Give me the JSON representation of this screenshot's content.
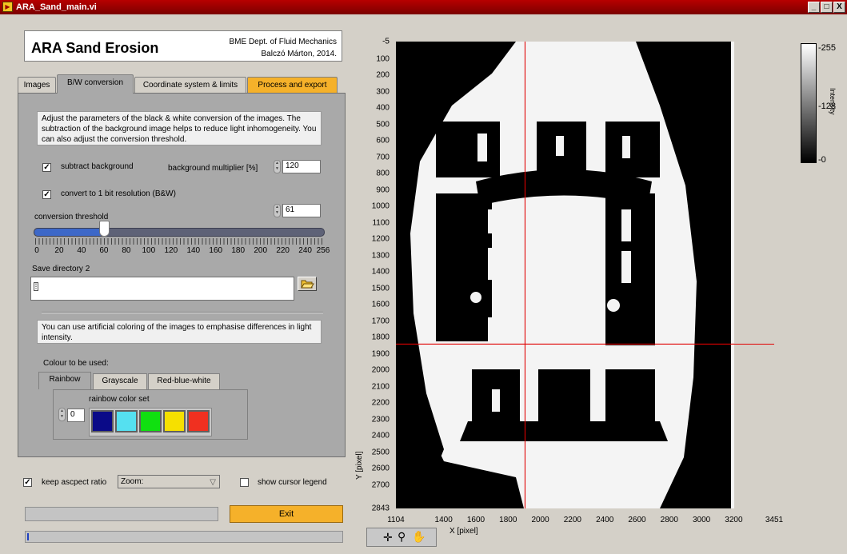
{
  "window": {
    "title": "ARA_Sand_main.vi",
    "min": "_",
    "max": "□",
    "close": "X"
  },
  "header": {
    "app_title": "ARA Sand Erosion",
    "dept": "BME Dept. of Fluid Mechanics",
    "author": "Balczó Márton, 2014."
  },
  "tabs": [
    {
      "label": "Images"
    },
    {
      "label": "B/W conversion"
    },
    {
      "label": "Coordinate system & limits"
    },
    {
      "label": "Process and export"
    }
  ],
  "bw": {
    "description": "Adjust  the parameters of the black & white conversion of the images. The subtraction of the background image helps to  reduce light inhomogeneity. You can also adjust the conversion threshold.",
    "subtract_label": "subtract background",
    "multiplier_label": "background multiplier [%]",
    "multiplier_value": "120",
    "convert_label": "convert to 1 bit resolution (B&W)",
    "threshold_label": "conversion threshold",
    "threshold_value": "61",
    "threshold_fraction": 0.238,
    "ticks": [
      "0",
      "20",
      "40",
      "60",
      "80",
      "100",
      "120",
      "140",
      "160",
      "180",
      "200",
      "220",
      "240",
      "256"
    ],
    "save_dir_label": "Save directory 2",
    "save_dir_value": "",
    "coloring_note": "You can use artificial coloring of the images to emphasise differences in light intensity.",
    "colour_label": "Colour to be used:",
    "colour_tabs": [
      {
        "label": "Rainbow"
      },
      {
        "label": "Grayscale"
      },
      {
        "label": "Red-blue-white"
      }
    ],
    "rainbow_label": "rainbow color set",
    "rainbow_index": "0",
    "swatches": [
      "#0a0a88",
      "#55e0f0",
      "#10e010",
      "#f6e000",
      "#f03020"
    ]
  },
  "bottom": {
    "keep_aspect_label": "keep ascpect ratio",
    "zoom_value": "Zoom:",
    "cursor_legend_label": "show cursor legend",
    "exit_label": "Exit"
  },
  "graph": {
    "y_ticks": [
      "-5",
      "100",
      "200",
      "300",
      "400",
      "500",
      "600",
      "700",
      "800",
      "900",
      "1000",
      "1100",
      "1200",
      "1300",
      "1400",
      "1500",
      "1600",
      "1700",
      "1800",
      "1900",
      "2000",
      "2100",
      "2200",
      "2300",
      "2400",
      "2500",
      "2600",
      "2700",
      "2843"
    ],
    "x_ticks": [
      "1104",
      "1400",
      "1600",
      "1800",
      "2000",
      "2200",
      "2400",
      "2600",
      "2800",
      "3000",
      "3200",
      "3451"
    ],
    "x_label": "X [pixel]",
    "y_label": "Y [pixel]",
    "cursor_x": 1905,
    "cursor_y": 1840,
    "colorbar_labels": [
      "255",
      "128",
      "0"
    ],
    "colorbar_title": "Intensity",
    "colors": {
      "cursor": "#e00000"
    }
  }
}
